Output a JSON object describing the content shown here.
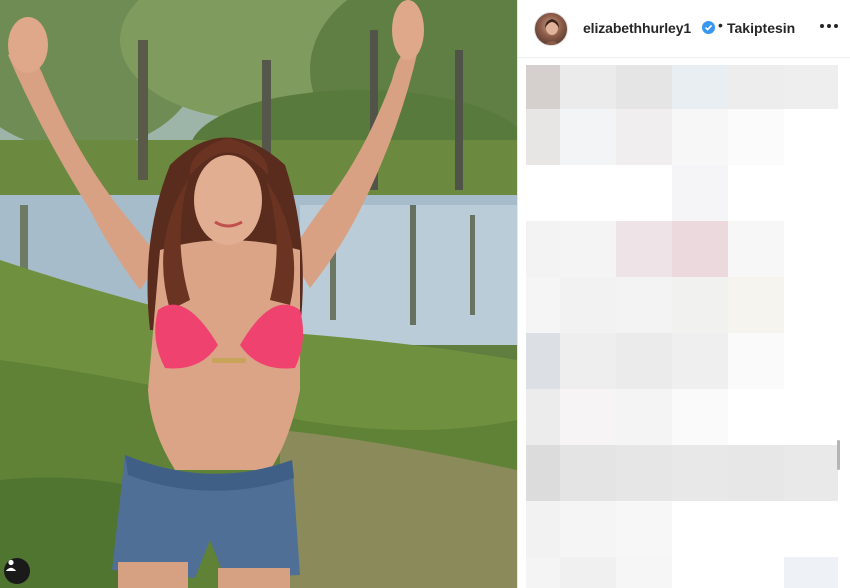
{
  "post": {
    "author": {
      "username": "elizabethhurley1",
      "verified": true,
      "separator": "•",
      "follow_status": "Takiptesin"
    },
    "photo": {
      "icon": "user-tag-icon"
    },
    "header_icons": {
      "verified": "verified-badge-icon",
      "more": "more-options-icon"
    },
    "comments_area": {
      "state": "pixelated"
    }
  },
  "colors": {
    "verified_badge": "#3897f0",
    "text_primary": "#262626",
    "bikini_pink": "#f0426e"
  }
}
